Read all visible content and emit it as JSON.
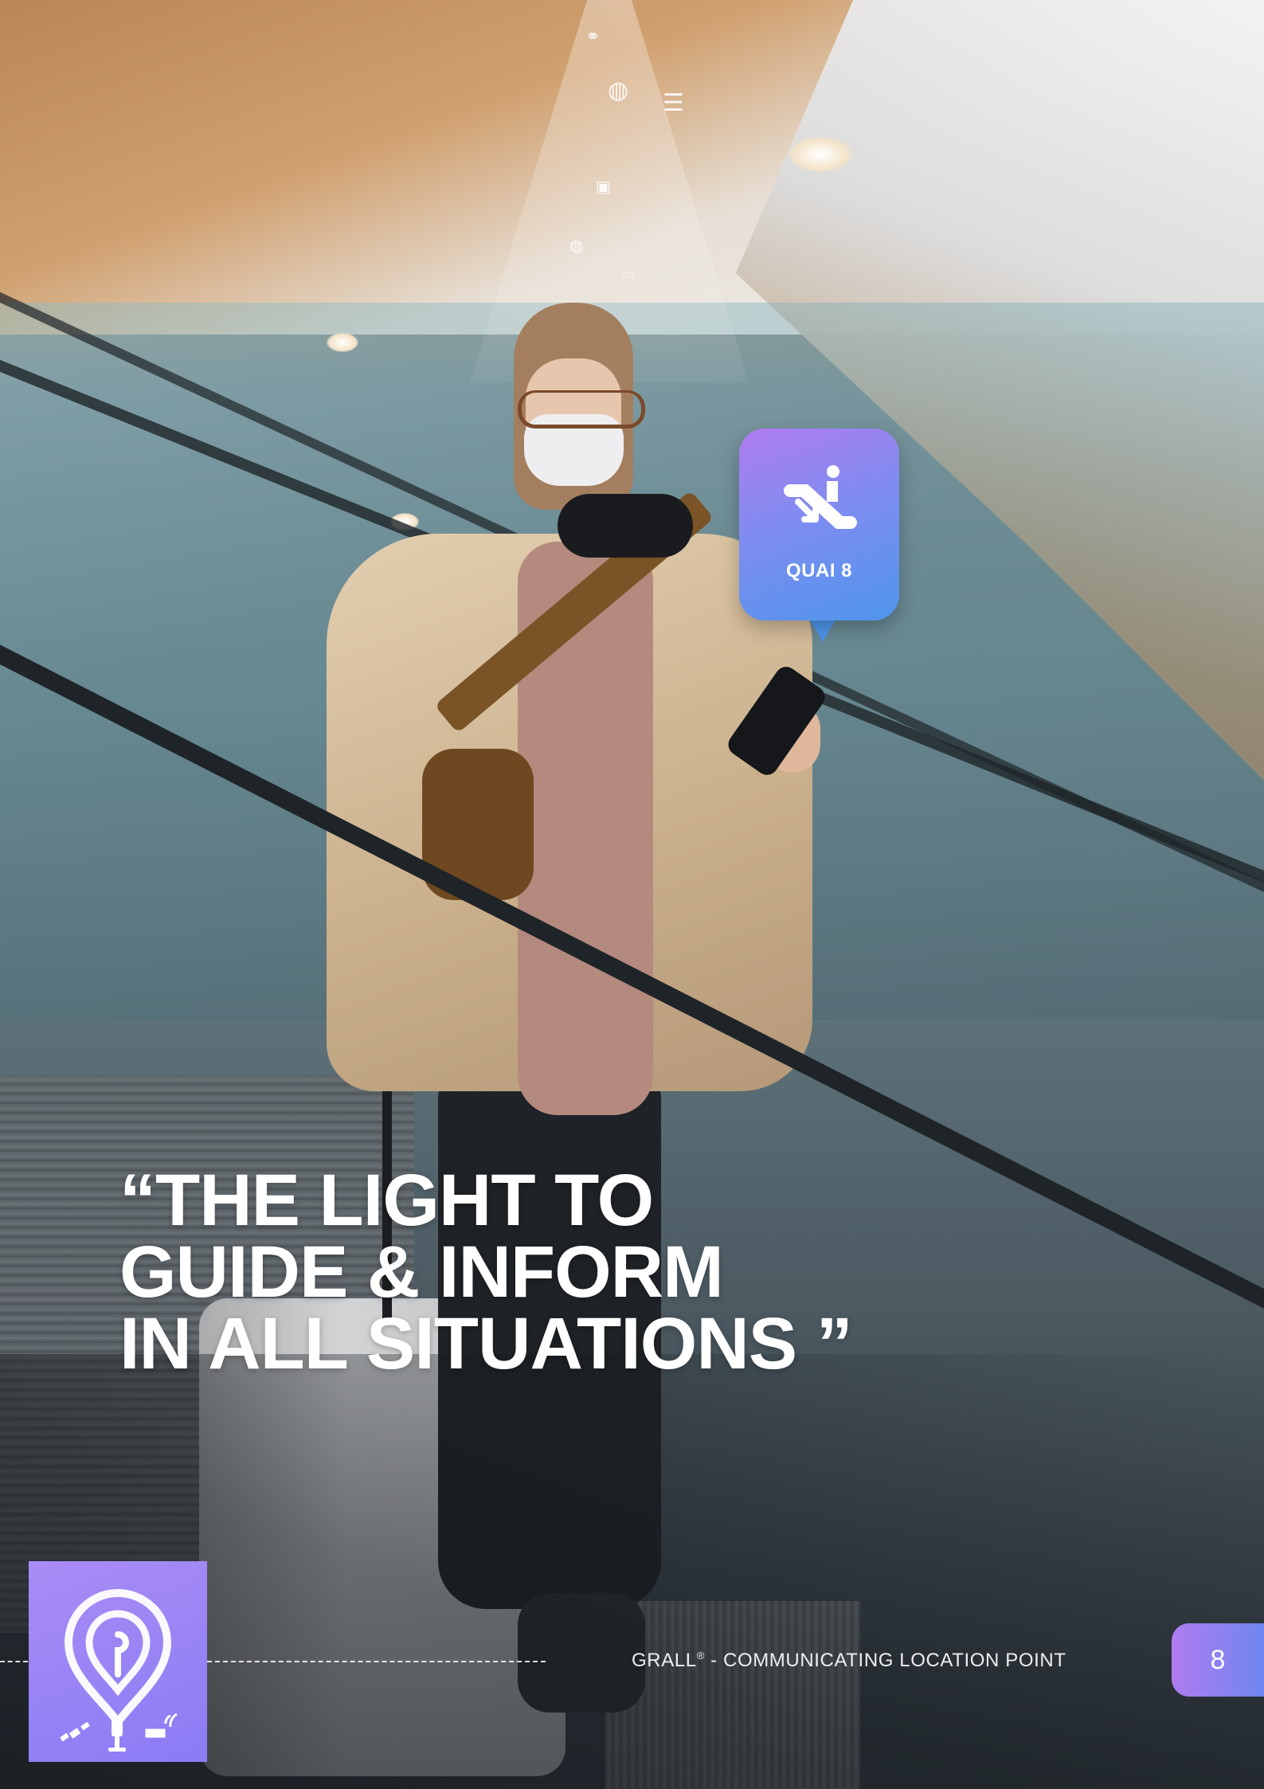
{
  "headline": {
    "line1": "“THE LIGHT TO",
    "line2": "GUIDE & INFORM",
    "line3": "IN ALL SITUATIONS ”"
  },
  "pin_card": {
    "label": "QUAI 8",
    "icon": "escalator-down-icon",
    "gradient_start": "#b07cf0",
    "gradient_end": "#4f96ec"
  },
  "light_beam_icons": [
    "link-icon",
    "globe-icon",
    "list-icon",
    "document-icon",
    "globe-icon",
    "message-icon"
  ],
  "logo": {
    "icon": "location-pin-icon",
    "sub_icons": [
      "satellite-icon",
      "usb-plug-icon",
      "broadcast-icon"
    ],
    "color": "#9d86f5"
  },
  "footer": {
    "brand": "GRALL",
    "registered": "®",
    "tagline": " - COMMUNICATING LOCATION POINT",
    "page_number": "8"
  },
  "colors": {
    "accent_purple": "#b07cf0",
    "accent_blue": "#6e86f0"
  }
}
